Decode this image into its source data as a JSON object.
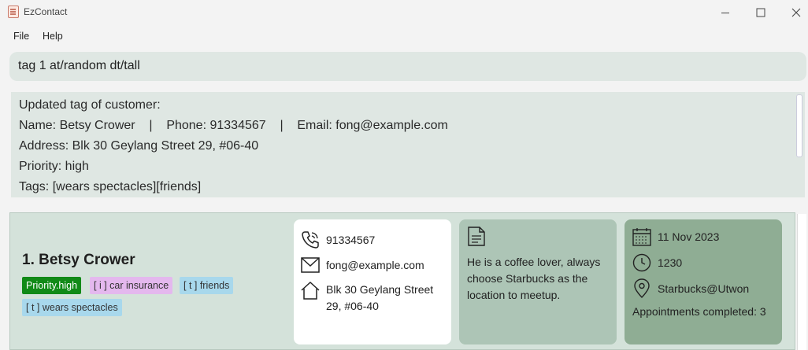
{
  "window": {
    "title": "EzContact"
  },
  "menu": {
    "file": "File",
    "help": "Help"
  },
  "command": {
    "value": "tag 1 at/random dt/tall"
  },
  "result": {
    "lines": [
      "Updated tag of customer:",
      "Name: Betsy Crower    |    Phone: 91334567    |    Email: fong@example.com",
      "Address: Blk 30 Geylang Street 29, #06-40",
      "Priority: high",
      "Tags: [wears spectacles][friends]"
    ]
  },
  "customer": {
    "index_name": "1.  Betsy Crower",
    "tags": {
      "priority": "Priority.high",
      "insurance": "[ i ] car insurance",
      "friends": "[ t ] friends",
      "spectacles": "[ t ] wears spectacles"
    },
    "contact": {
      "phone": "91334567",
      "email": "fong@example.com",
      "address_line1": "Blk 30 Geylang Street",
      "address_line2": "29, #06-40"
    },
    "note": "He is a coffee lover, always choose Starbucks as the location to meetup.",
    "appointment": {
      "date": "11 Nov 2023",
      "time": "1230",
      "venue": "Starbucks@Utwon",
      "completed": "Appointments completed: 3"
    }
  },
  "colors": {
    "command_bg": "#dfe7e3",
    "list_bg": "#d4e2da",
    "note_card": "#adc5b6",
    "appt_card": "#8fad94",
    "priority_tag": "#118a17",
    "insurance_tag": "#e4b8ee",
    "generic_tag": "#a8d8ec"
  },
  "icons": [
    "app-icon",
    "minimize-icon",
    "maximize-icon",
    "close-icon",
    "phone-icon",
    "email-icon",
    "home-icon",
    "note-icon",
    "calendar-icon",
    "clock-icon",
    "location-icon"
  ]
}
